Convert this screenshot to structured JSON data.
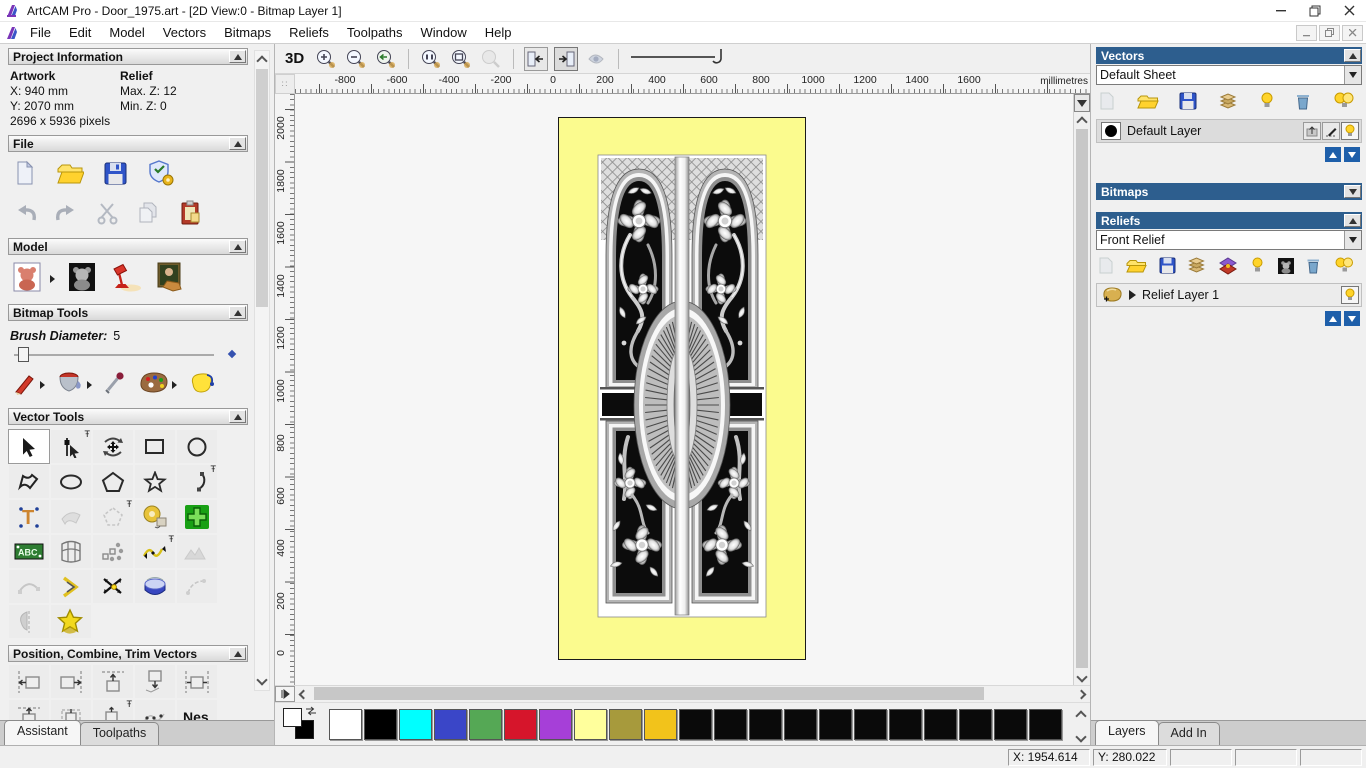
{
  "window": {
    "title": "ArtCAM Pro - Door_1975.art - [2D View:0 - Bitmap Layer 1]"
  },
  "menu": {
    "items": [
      "File",
      "Edit",
      "Model",
      "Vectors",
      "Bitmaps",
      "Reliefs",
      "Toolpaths",
      "Window",
      "Help"
    ]
  },
  "assistant_panel": {
    "project_information": {
      "title": "Project Information",
      "artwork_label": "Artwork",
      "relief_label": "Relief",
      "x": "X: 940 mm",
      "y": "Y: 2070 mm",
      "pixels": "2696 x 5936 pixels",
      "max_z": "Max. Z: 12",
      "min_z": "Min. Z: 0"
    },
    "file_section_title": "File",
    "model_section_title": "Model",
    "bitmap_tools_title": "Bitmap Tools",
    "brush_diameter_label": "Brush Diameter:",
    "brush_diameter_value": "5",
    "vector_tools_title": "Vector Tools",
    "position_section_title": "Position, Combine, Trim Vectors",
    "tabs": [
      "Assistant",
      "Toolpaths"
    ]
  },
  "canvas": {
    "toolbar_3d_label": "3D",
    "ruler_unit": "millimetres",
    "top_ruler_ticks": [
      "-800",
      "-600",
      "-400",
      "-200",
      "0",
      "200",
      "400",
      "600",
      "800",
      "1000",
      "1200",
      "1400",
      "1600"
    ],
    "left_ruler_ticks": [
      "2000",
      "1800",
      "1600",
      "1400",
      "1200",
      "1000",
      "800",
      "600",
      "400",
      "200",
      "0"
    ]
  },
  "vectors_panel": {
    "title": "Vectors",
    "sheet_selector": "Default Sheet",
    "layer_name": "Default Layer"
  },
  "bitmaps_panel": {
    "title": "Bitmaps"
  },
  "reliefs_panel": {
    "title": "Reliefs",
    "relief_selector": "Front Relief",
    "layer_name": "Relief Layer 1"
  },
  "right_tabs": [
    "Layers",
    "Add In"
  ],
  "palette": {
    "colors": [
      "#ffffff",
      "#000000",
      "#00ffff",
      "#3a46c8",
      "#55a855",
      "#d6152b",
      "#a63fd8",
      "#ffff9c",
      "#a79a3c",
      "#f2c31b",
      "#0a0a0a",
      "#0a0a0a",
      "#0a0a0a",
      "#0a0a0a",
      "#0a0a0a",
      "#0a0a0a",
      "#0a0a0a",
      "#0a0a0a",
      "#0a0a0a",
      "#0a0a0a",
      "#0a0a0a"
    ]
  },
  "status_bar": {
    "x": "X: 1954.614",
    "y": "Y: 280.022"
  },
  "icon_text": {
    "abc": "ABC",
    "text_tool": "T",
    "nesting": "Nes"
  },
  "door": {
    "background": "#fbfb8e"
  }
}
